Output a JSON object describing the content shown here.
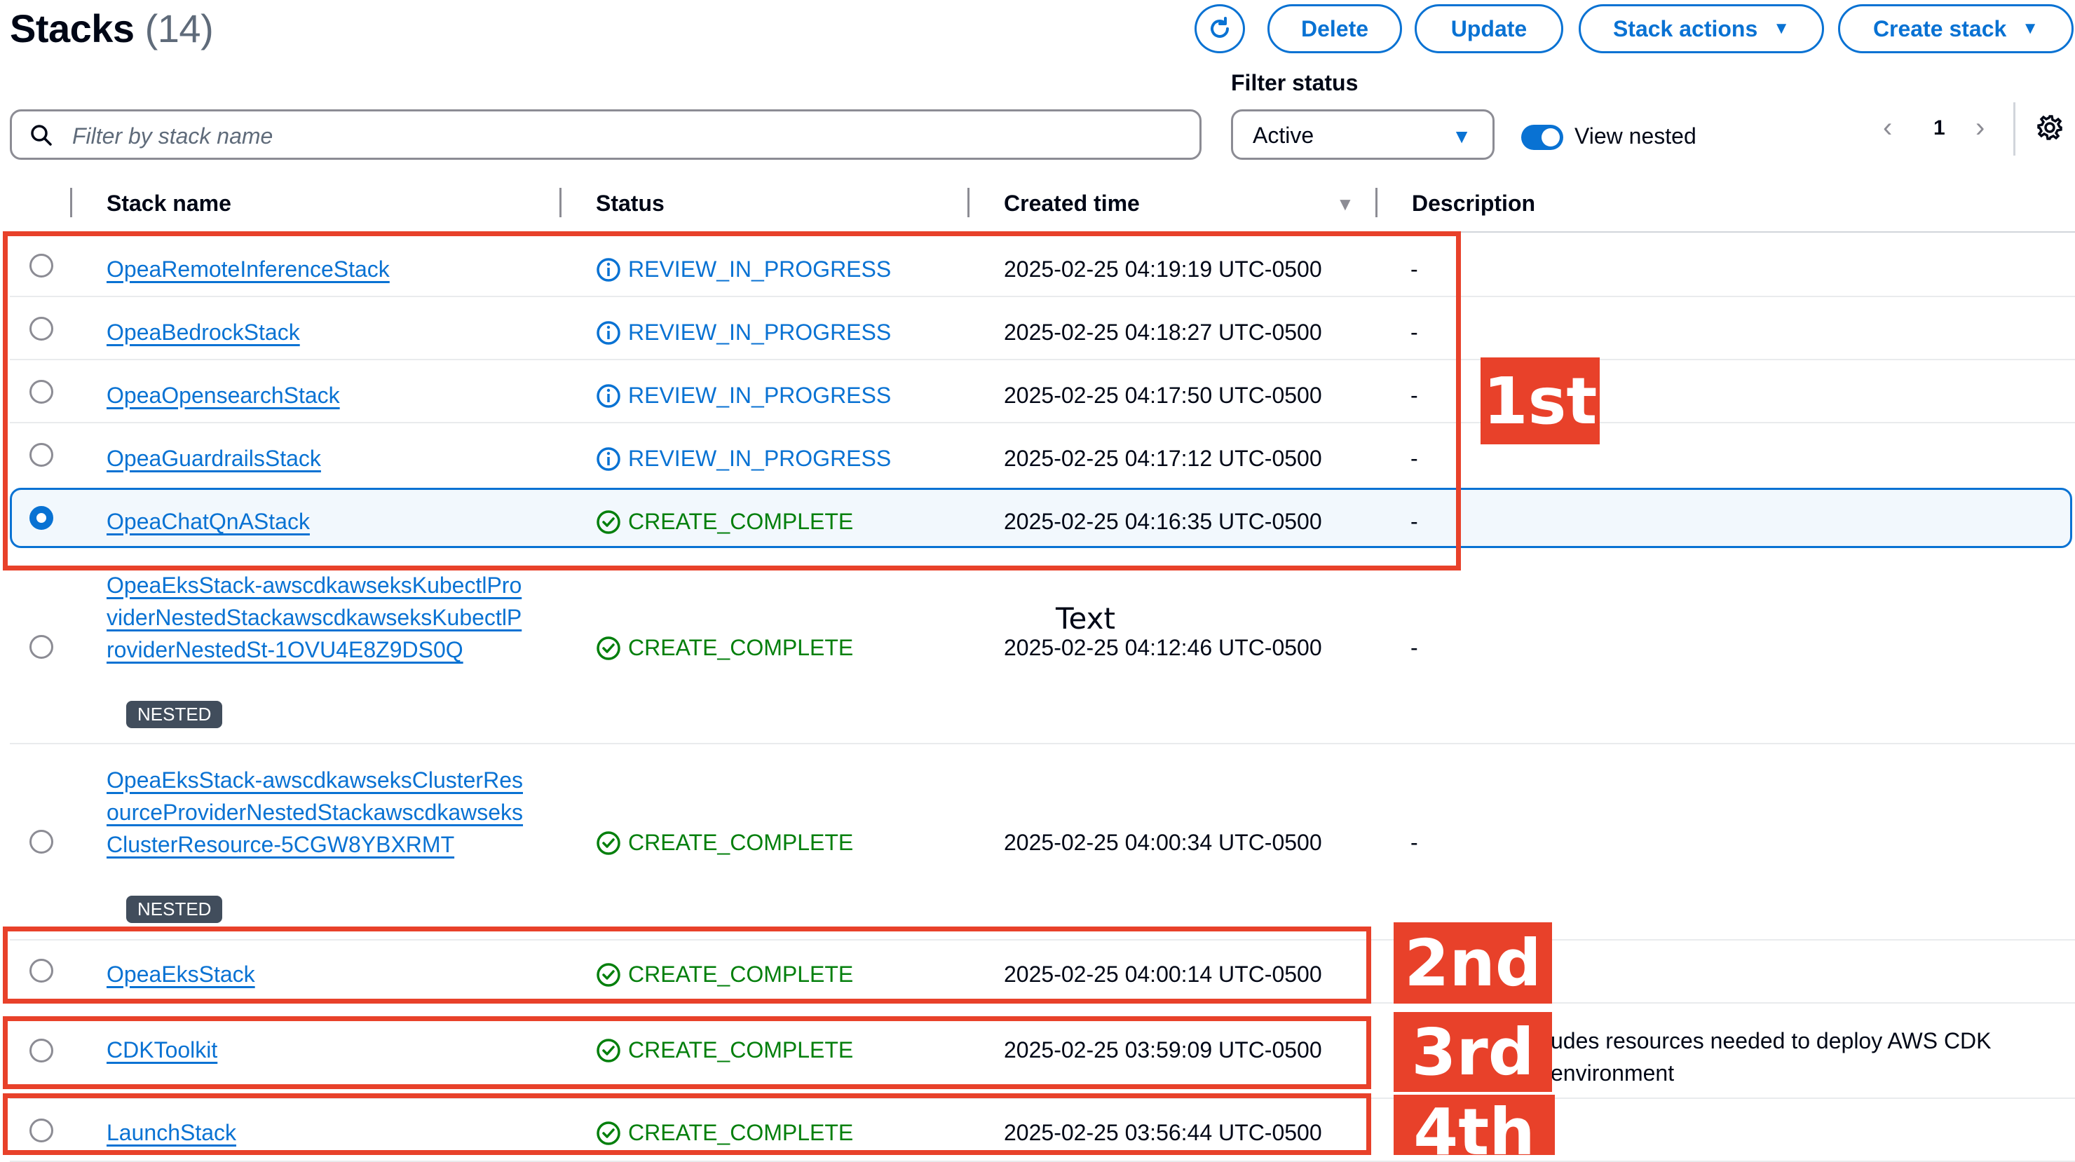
{
  "header": {
    "title": "Stacks",
    "count": "(14)",
    "buttons": {
      "delete": "Delete",
      "update": "Update",
      "stack_actions": "Stack actions",
      "create_stack": "Create stack"
    }
  },
  "filters": {
    "search_placeholder": "Filter by stack name",
    "status_label": "Filter status",
    "status_value": "Active",
    "view_nested_label": "View nested",
    "view_nested_on": true
  },
  "pagination": {
    "current_page": "1"
  },
  "table": {
    "columns": {
      "name": "Stack name",
      "status": "Status",
      "created": "Created time",
      "description": "Description"
    },
    "rows": [
      {
        "name": "OpeaRemoteInferenceStack",
        "status": "REVIEW_IN_PROGRESS",
        "created": "2025-02-25 04:19:19 UTC-0500",
        "description": "-"
      },
      {
        "name": "OpeaBedrockStack",
        "status": "REVIEW_IN_PROGRESS",
        "created": "2025-02-25 04:18:27 UTC-0500",
        "description": "-"
      },
      {
        "name": "OpeaOpensearchStack",
        "status": "REVIEW_IN_PROGRESS",
        "created": "2025-02-25 04:17:50 UTC-0500",
        "description": "-"
      },
      {
        "name": "OpeaGuardrailsStack",
        "status": "REVIEW_IN_PROGRESS",
        "created": "2025-02-25 04:17:12 UTC-0500",
        "description": "-"
      },
      {
        "name": "OpeaChatQnAStack",
        "status": "CREATE_COMPLETE",
        "created": "2025-02-25 04:16:35 UTC-0500",
        "description": "-",
        "selected": true
      },
      {
        "name": "OpeaEksStack-awscdkawseksKubectlProviderNestedStackawscdkawseksKubectlProviderNestedSt-1OVU4E8Z9DS0Q",
        "badge": "NESTED",
        "status": "CREATE_COMPLETE",
        "created": "2025-02-25 04:12:46 UTC-0500",
        "description": "-"
      },
      {
        "name": "OpeaEksStack-awscdkawseksClusterResourceProviderNestedStackawscdkawseksClusterResource-5CGW8YBXRMT",
        "badge": "NESTED",
        "status": "CREATE_COMPLETE",
        "created": "2025-02-25 04:00:34 UTC-0500",
        "description": "-"
      },
      {
        "name": "OpeaEksStack",
        "status": "CREATE_COMPLETE",
        "created": "2025-02-25 04:00:14 UTC-0500",
        "description": ""
      },
      {
        "name": "CDKToolkit",
        "status": "CREATE_COMPLETE",
        "created": "2025-02-25 03:59:09 UTC-0500",
        "description": "udes resources needed to deploy AWS CDK environment"
      },
      {
        "name": "LaunchStack",
        "status": "CREATE_COMPLETE",
        "created": "2025-02-25 03:56:44 UTC-0500",
        "description": ""
      }
    ]
  },
  "annotations": {
    "first": "1st",
    "second": "2nd",
    "third": "3rd",
    "fourth": "4th",
    "text_note": "Text"
  },
  "colors": {
    "accent": "#0972d3",
    "success": "#037f0c",
    "annotation": "#e8412a"
  }
}
